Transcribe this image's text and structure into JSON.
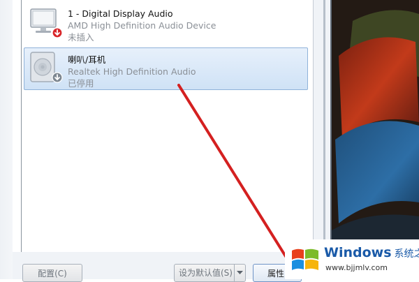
{
  "devices": [
    {
      "name": "1 - Digital Display Audio",
      "description": "AMD High Definition Audio Device",
      "status": "未插入",
      "icon": "monitor-icon",
      "badge": "red-down-arrow-badge"
    },
    {
      "name": "喇叭/耳机",
      "description": "Realtek High Definition Audio",
      "status": "已停用",
      "icon": "speaker-icon",
      "badge": "gray-down-arrow-badge"
    }
  ],
  "buttons": {
    "configure": "配置(C)",
    "set_default": "设为默认值(S)",
    "properties": "属性"
  },
  "watermark": {
    "title": "Windows",
    "title_cn": "系统之家",
    "url": "www.bjjmlv.com"
  },
  "colors": {
    "selection": "#cfe2f6",
    "arrow": "#d42020",
    "watermark_blue": "#1a5aa8"
  }
}
